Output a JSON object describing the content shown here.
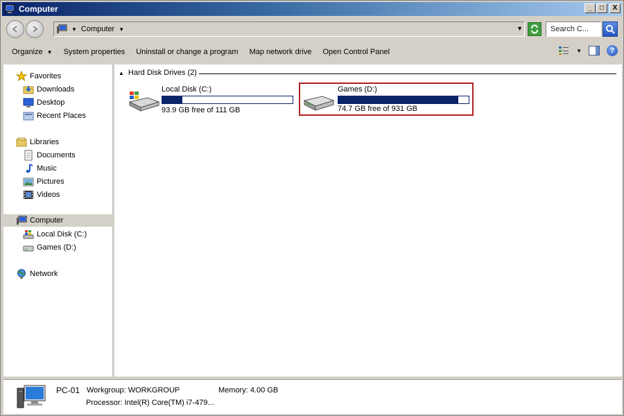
{
  "window": {
    "title": "Computer"
  },
  "title_buttons": {
    "minimize": "_",
    "maximize": "□",
    "close": "X"
  },
  "address": {
    "crumb": "Computer"
  },
  "search": {
    "placeholder": "Search C..."
  },
  "toolbar": {
    "organize": "Organize",
    "system_properties": "System properties",
    "uninstall": "Uninstall or change a program",
    "map_drive": "Map network drive",
    "control_panel": "Open Control Panel"
  },
  "nav": {
    "favorites": "Favorites",
    "downloads": "Downloads",
    "desktop": "Desktop",
    "recent": "Recent Places",
    "libraries": "Libraries",
    "documents": "Documents",
    "music": "Music",
    "pictures": "Pictures",
    "videos": "Videos",
    "computer": "Computer",
    "local_disk": "Local Disk (C:)",
    "games": "Games (D:)",
    "network": "Network"
  },
  "content": {
    "group_title": "Hard Disk Drives (2)",
    "drives": [
      {
        "name": "Local Disk (C:)",
        "free_text": "93.9 GB free of 111 GB",
        "used_fraction": 0.154
      },
      {
        "name": "Games (D:)",
        "free_text": "74.7 GB free of 931 GB",
        "used_fraction": 0.92
      }
    ]
  },
  "details": {
    "pc_name": "PC-01",
    "workgroup": "Workgroup: WORKGROUP",
    "memory": "Memory: 4.00 GB",
    "processor": "Processor: Intel(R) Core(TM) i7-479..."
  },
  "colors": {
    "title_start": "#0a246a",
    "bar_fill": "#0a246a",
    "highlight_border": "#b02020"
  }
}
